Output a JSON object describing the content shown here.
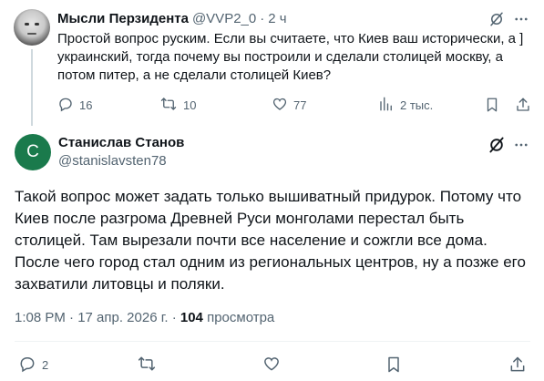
{
  "parent_tweet": {
    "author_name": "Мысли Перзидента",
    "handle": "@VVP2_0",
    "separator": "·",
    "time": "2 ч",
    "text": "Простой вопрос руским. Если вы считаете, что Киев ваш исторически, а ] украинский, тогда почему вы построили и сделали столицей москву, а потом питер, а не сделали столицей Киев?",
    "replies": "16",
    "retweets": "10",
    "likes": "77",
    "views": "2 тыс."
  },
  "reply_tweet": {
    "avatar_letter": "C",
    "author_name": "Станислав Станов",
    "handle": "@stanislavsten78",
    "text": "Такой вопрос может задать только вышиватный придурок. Потому что Киев после разгрома Древней Руси монголами перестал быть столицей. Там вырезали почти все население и сожгли все дома. После чего город стал одним из региональных центров, ну а позже его захватили литовцы и поляки.",
    "timestamp": "1:08 PM · 17 апр. 2026 г. · ",
    "view_count": "104",
    "views_label": " просмотра",
    "replies": "2"
  },
  "colors": {
    "text_primary": "#0f1419",
    "text_secondary": "#536471",
    "divider": "#eff3f4",
    "reply_avatar_bg": "#1a7a4c"
  },
  "icons": [
    "grok-icon",
    "more-icon",
    "reply-icon",
    "retweet-icon",
    "like-icon",
    "views-icon",
    "bookmark-icon",
    "share-icon"
  ]
}
